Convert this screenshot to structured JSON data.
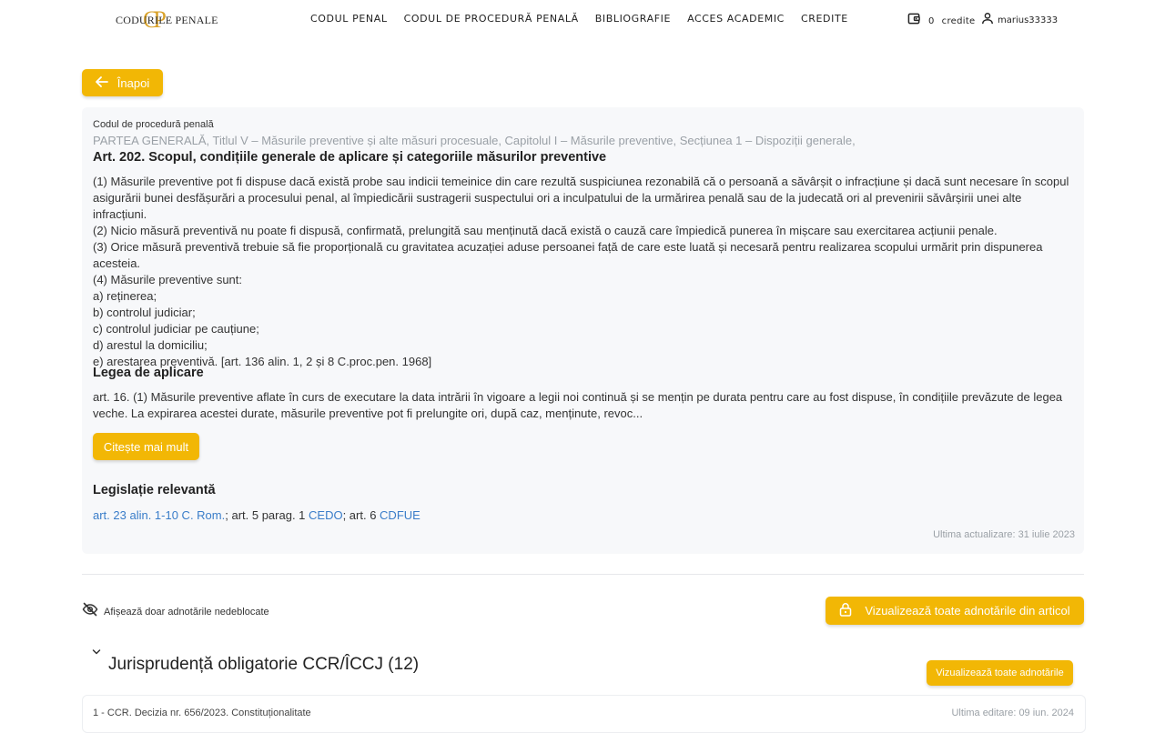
{
  "header": {
    "logo_text": "CODURILE PENALE",
    "logo_mark": "CP",
    "nav": [
      "CODUL PENAL",
      "CODUL DE PROCEDURĂ PENALĂ",
      "BIBLIOGRAFIE",
      "ACCES ACADEMIC",
      "CREDITE"
    ],
    "credits_count": "0",
    "credits_label": "credite",
    "username": "marius33333"
  },
  "back_label": "Înapoi",
  "article": {
    "code_name": "Codul de procedură penală",
    "breadcrumb": "PARTEA GENERALĂ, Titlul V – Măsurile preventive și alte măsuri procesuale, Capitolul I – Măsurile preventive, Secțiunea 1 – Dispoziții generale,",
    "title": "Art. 202. Scopul, condițiile generale de aplicare și categoriile măsurilor preventive",
    "paragraphs": [
      "(1) Măsurile preventive pot fi dispuse dacă există probe sau indicii temeinice din care rezultă suspiciunea rezonabilă că o persoană a săvârșit o infracțiune și dacă sunt necesare în scopul asigurării bunei desfășurări a procesului penal, al împiedicării sustragerii suspectului ori a inculpatului de la urmărirea penală sau de la judecată ori al prevenirii săvârșirii unei alte infracțiuni.",
      "(2) Nicio măsură preventivă nu poate fi dispusă, confirmată, prelungită sau menținută dacă există o cauză care împiedică punerea în mișcare sau exercitarea acțiunii penale.",
      "(3) Orice măsură preventivă trebuie să fie proporțională cu gravitatea acuzației aduse persoanei față de care este luată și necesară pentru realizarea scopului urmărit prin dispunerea acesteia.",
      "(4) Măsurile preventive sunt:",
      "a) reținerea;",
      "b) controlul judiciar;",
      "c) controlul judiciar pe cauțiune;",
      "d) arestul la domiciliu;",
      "e) arestarea preventivă. [art. 136 alin. 1, 2 și 8 C.proc.pen. 1968]"
    ],
    "law_section_title": "Legea de aplicare",
    "law_text": "art. 16. (1) Măsurile preventive aflate în curs de executare la data intrării în vigoare a legii noi continuă și se mențin pe durata pentru care au fost dispuse, în condițiile prevăzute de legea veche. La expirarea acestei durate, măsurile preventive pot fi prelungite ori, după caz, menținute, revoc...",
    "read_more": "Citește mai mult",
    "legis_title": "Legislație relevantă",
    "legis": {
      "link1": "art. 23 alin. 1-10 C. Rom.",
      "sep1": "; art. 5 parag. 1 ",
      "link2": "CEDO",
      "sep2": "; art. 6 ",
      "link3": "CDFUE"
    },
    "updated": "Ultima actualizare: 31 iulie 2023"
  },
  "annotations": {
    "toggle_label": "Afișează doar adnotările nedeblocate",
    "view_all_article": "Vizualizează toate adnotările din articol",
    "section_title": "Jurisprudență obligatorie CCR/ÎCCJ (12)",
    "view_all_notes": "Vizualizează toate adnotările",
    "rows": [
      {
        "label": "1 - CCR. Decizia nr. 656/2023. Constituționalitate",
        "date": "Ultima editare: 09 iun. 2024"
      }
    ]
  },
  "colors": {
    "accent": "#f2b705",
    "link": "#3a7dc9",
    "muted": "#9aa0a6"
  },
  "icons": [
    "wallet-icon",
    "user-icon",
    "arrow-left-icon",
    "eye-off-icon",
    "lock-icon",
    "chevron-down-icon"
  ]
}
